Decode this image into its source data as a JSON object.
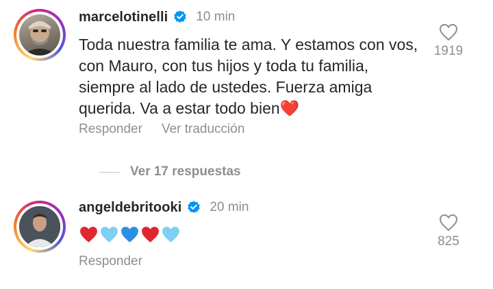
{
  "comments": [
    {
      "username": "marcelotinelli",
      "time": "10 min",
      "text": "Toda nuestra familia te ama. Y estamos con vos, con Mauro, con tus hijos y toda tu familia, siempre al lado de ustedes. Fuerza amiga querida. Va a estar todo bien❤️",
      "likes": "1919",
      "reply_label": "Responder",
      "translate_label": "Ver traducción"
    },
    {
      "username": "angeldebritooki",
      "time": "20 min",
      "emojis": [
        "❤️",
        "🩵",
        "💙",
        "❤️",
        "🩵"
      ],
      "likes": "825",
      "reply_label": "Responder"
    }
  ],
  "view_replies_label": "Ver 17 respuestas",
  "colors": {
    "verified": "#0095f6",
    "secondary_text": "#8e8e8e",
    "primary_text": "#262626"
  }
}
